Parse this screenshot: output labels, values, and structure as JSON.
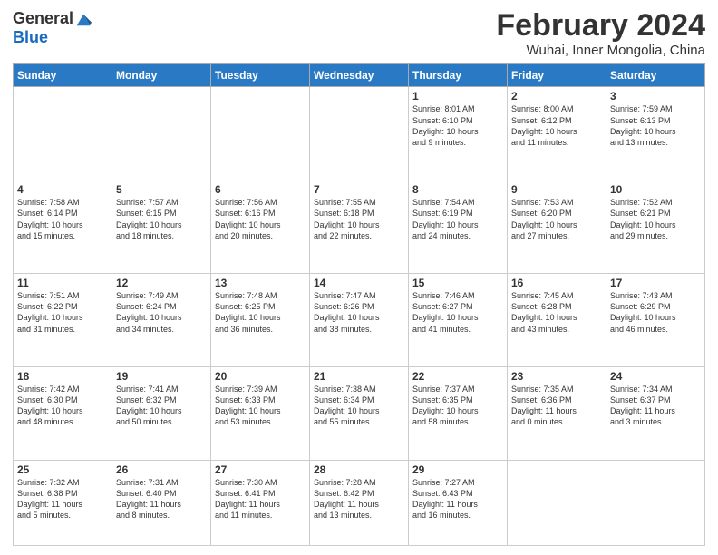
{
  "header": {
    "logo_general": "General",
    "logo_blue": "Blue",
    "month_year": "February 2024",
    "location": "Wuhai, Inner Mongolia, China"
  },
  "days_of_week": [
    "Sunday",
    "Monday",
    "Tuesday",
    "Wednesday",
    "Thursday",
    "Friday",
    "Saturday"
  ],
  "weeks": [
    [
      {
        "day": "",
        "info": ""
      },
      {
        "day": "",
        "info": ""
      },
      {
        "day": "",
        "info": ""
      },
      {
        "day": "",
        "info": ""
      },
      {
        "day": "1",
        "info": "Sunrise: 8:01 AM\nSunset: 6:10 PM\nDaylight: 10 hours\nand 9 minutes."
      },
      {
        "day": "2",
        "info": "Sunrise: 8:00 AM\nSunset: 6:12 PM\nDaylight: 10 hours\nand 11 minutes."
      },
      {
        "day": "3",
        "info": "Sunrise: 7:59 AM\nSunset: 6:13 PM\nDaylight: 10 hours\nand 13 minutes."
      }
    ],
    [
      {
        "day": "4",
        "info": "Sunrise: 7:58 AM\nSunset: 6:14 PM\nDaylight: 10 hours\nand 15 minutes."
      },
      {
        "day": "5",
        "info": "Sunrise: 7:57 AM\nSunset: 6:15 PM\nDaylight: 10 hours\nand 18 minutes."
      },
      {
        "day": "6",
        "info": "Sunrise: 7:56 AM\nSunset: 6:16 PM\nDaylight: 10 hours\nand 20 minutes."
      },
      {
        "day": "7",
        "info": "Sunrise: 7:55 AM\nSunset: 6:18 PM\nDaylight: 10 hours\nand 22 minutes."
      },
      {
        "day": "8",
        "info": "Sunrise: 7:54 AM\nSunset: 6:19 PM\nDaylight: 10 hours\nand 24 minutes."
      },
      {
        "day": "9",
        "info": "Sunrise: 7:53 AM\nSunset: 6:20 PM\nDaylight: 10 hours\nand 27 minutes."
      },
      {
        "day": "10",
        "info": "Sunrise: 7:52 AM\nSunset: 6:21 PM\nDaylight: 10 hours\nand 29 minutes."
      }
    ],
    [
      {
        "day": "11",
        "info": "Sunrise: 7:51 AM\nSunset: 6:22 PM\nDaylight: 10 hours\nand 31 minutes."
      },
      {
        "day": "12",
        "info": "Sunrise: 7:49 AM\nSunset: 6:24 PM\nDaylight: 10 hours\nand 34 minutes."
      },
      {
        "day": "13",
        "info": "Sunrise: 7:48 AM\nSunset: 6:25 PM\nDaylight: 10 hours\nand 36 minutes."
      },
      {
        "day": "14",
        "info": "Sunrise: 7:47 AM\nSunset: 6:26 PM\nDaylight: 10 hours\nand 38 minutes."
      },
      {
        "day": "15",
        "info": "Sunrise: 7:46 AM\nSunset: 6:27 PM\nDaylight: 10 hours\nand 41 minutes."
      },
      {
        "day": "16",
        "info": "Sunrise: 7:45 AM\nSunset: 6:28 PM\nDaylight: 10 hours\nand 43 minutes."
      },
      {
        "day": "17",
        "info": "Sunrise: 7:43 AM\nSunset: 6:29 PM\nDaylight: 10 hours\nand 46 minutes."
      }
    ],
    [
      {
        "day": "18",
        "info": "Sunrise: 7:42 AM\nSunset: 6:30 PM\nDaylight: 10 hours\nand 48 minutes."
      },
      {
        "day": "19",
        "info": "Sunrise: 7:41 AM\nSunset: 6:32 PM\nDaylight: 10 hours\nand 50 minutes."
      },
      {
        "day": "20",
        "info": "Sunrise: 7:39 AM\nSunset: 6:33 PM\nDaylight: 10 hours\nand 53 minutes."
      },
      {
        "day": "21",
        "info": "Sunrise: 7:38 AM\nSunset: 6:34 PM\nDaylight: 10 hours\nand 55 minutes."
      },
      {
        "day": "22",
        "info": "Sunrise: 7:37 AM\nSunset: 6:35 PM\nDaylight: 10 hours\nand 58 minutes."
      },
      {
        "day": "23",
        "info": "Sunrise: 7:35 AM\nSunset: 6:36 PM\nDaylight: 11 hours\nand 0 minutes."
      },
      {
        "day": "24",
        "info": "Sunrise: 7:34 AM\nSunset: 6:37 PM\nDaylight: 11 hours\nand 3 minutes."
      }
    ],
    [
      {
        "day": "25",
        "info": "Sunrise: 7:32 AM\nSunset: 6:38 PM\nDaylight: 11 hours\nand 5 minutes."
      },
      {
        "day": "26",
        "info": "Sunrise: 7:31 AM\nSunset: 6:40 PM\nDaylight: 11 hours\nand 8 minutes."
      },
      {
        "day": "27",
        "info": "Sunrise: 7:30 AM\nSunset: 6:41 PM\nDaylight: 11 hours\nand 11 minutes."
      },
      {
        "day": "28",
        "info": "Sunrise: 7:28 AM\nSunset: 6:42 PM\nDaylight: 11 hours\nand 13 minutes."
      },
      {
        "day": "29",
        "info": "Sunrise: 7:27 AM\nSunset: 6:43 PM\nDaylight: 11 hours\nand 16 minutes."
      },
      {
        "day": "",
        "info": ""
      },
      {
        "day": "",
        "info": ""
      }
    ]
  ]
}
